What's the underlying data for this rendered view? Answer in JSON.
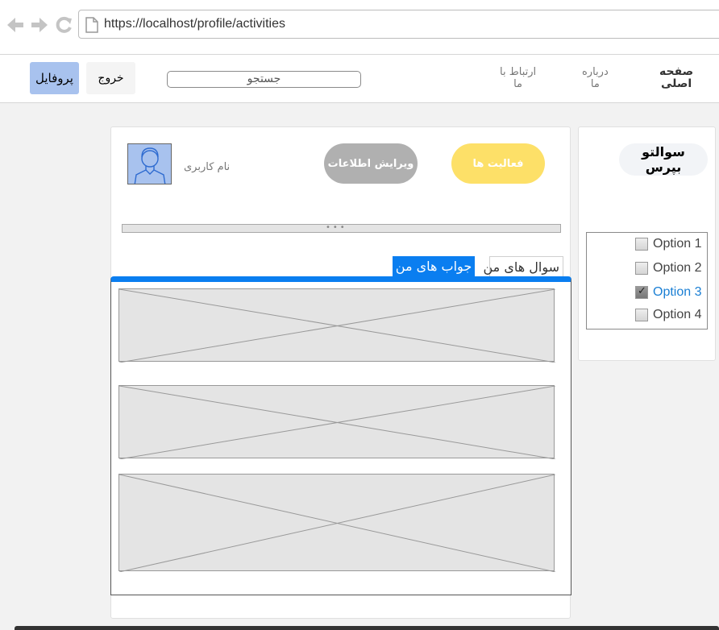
{
  "browser": {
    "url": "https://localhost/profile/activities",
    "back_icon": "back-arrow-icon",
    "forward_icon": "forward-arrow-icon",
    "reload_icon": "reload-icon"
  },
  "topnav": {
    "profile_label": "پروفایل",
    "logout_label": "خروج",
    "search_placeholder": "جستجو",
    "links": {
      "contact_line1": "ارتباط با",
      "contact_line2": "ما",
      "about_line1": "درباره",
      "about_line2": "ما",
      "home_line1": "صفحه",
      "home_line2": "اصلی"
    }
  },
  "sidebar": {
    "logo_line1": "سوالتو",
    "logo_line2": "بپرس",
    "options": [
      {
        "label": "Option 1",
        "checked": false
      },
      {
        "label": "Option 2",
        "checked": false
      },
      {
        "label": "Option 3",
        "checked": true
      },
      {
        "label": "Option 4",
        "checked": false
      }
    ]
  },
  "profile": {
    "username": "نام کاربری",
    "edit_label": "ویرایش اطلاعات",
    "activities_label": "فعالیت ها",
    "tabs": {
      "questions": "سوال های من",
      "answers": "جواب های من"
    }
  },
  "colors": {
    "accent_blue": "#0a7ef0",
    "profile_button": "#a8c2ee",
    "activities_button": "#fde068",
    "edit_button": "#b0b0b0",
    "link_active": "#1a7fd4"
  }
}
